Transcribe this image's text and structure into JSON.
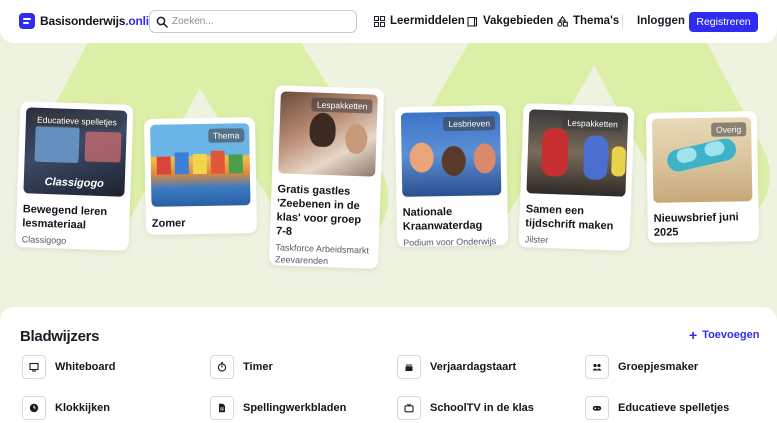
{
  "header": {
    "logo": {
      "brand": "Basisonderwijs",
      "suffix": ".online"
    },
    "search": {
      "placeholder": "Zoeken..."
    },
    "nav": [
      {
        "label": "Leermiddelen",
        "icon": "grid-icon"
      },
      {
        "label": "Vakgebieden",
        "icon": "book-icon"
      },
      {
        "label": "Thema's",
        "icon": "shapes-icon"
      }
    ],
    "login_label": "Inloggen",
    "register_label": "Registreren"
  },
  "colors": {
    "accent": "#2f2cf0",
    "hero_bg": "#eef3e0",
    "hero_shape": "#dcefa6"
  },
  "cards": [
    {
      "tag": "Educatieve spelletjes",
      "title": "Bewegend leren lesmateriaal",
      "sub": "Classigogo",
      "image_text": "Classigogo"
    },
    {
      "tag": "Thema",
      "title": "Zomer",
      "sub": ""
    },
    {
      "tag": "Lespakketten",
      "title": "Gratis gastles 'Zeebenen in de klas' voor groep 7-8",
      "sub": "Taskforce Arbeidsmarkt Zeevarenden"
    },
    {
      "tag": "Lesbrieven",
      "title": "Nationale Kraanwaterdag",
      "sub": "Podium voor Onderwijs"
    },
    {
      "tag": "Lespakketten",
      "title": "Samen een tijdschrift maken",
      "sub": "Jilster"
    },
    {
      "tag": "Overig",
      "title": "Nieuwsbrief juni 2025",
      "sub": ""
    }
  ],
  "bookmarks": {
    "title": "Bladwijzers",
    "add_label": "Toevoegen",
    "items": [
      {
        "label": "Whiteboard",
        "icon": "whiteboard-icon"
      },
      {
        "label": "Timer",
        "icon": "timer-icon"
      },
      {
        "label": "Verjaardagstaart",
        "icon": "cake-icon"
      },
      {
        "label": "Groepjesmaker",
        "icon": "group-icon"
      },
      {
        "label": "Klokkijken",
        "icon": "clock-icon"
      },
      {
        "label": "Spellingwerkbladen",
        "icon": "document-icon"
      },
      {
        "label": "SchoolTV in de klas",
        "icon": "tv-icon"
      },
      {
        "label": "Educatieve spelletjes",
        "icon": "gamepad-icon"
      }
    ]
  }
}
